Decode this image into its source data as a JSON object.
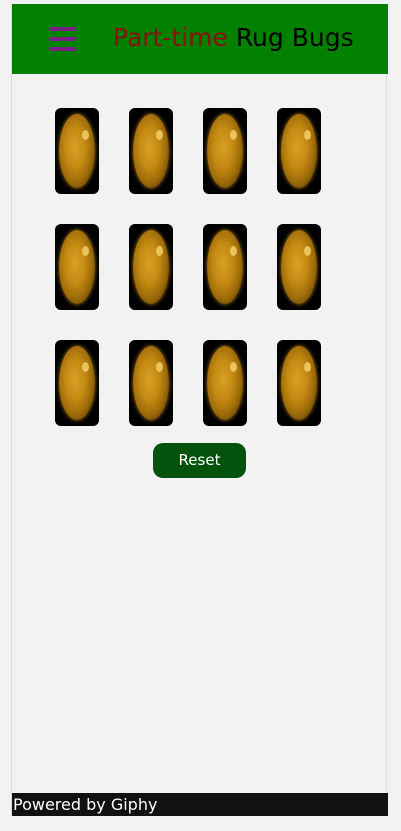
{
  "header": {
    "title_part1": "Part-time",
    "title_part2": "Rug Bugs",
    "menu_icon": "hamburger-menu-icon"
  },
  "colors": {
    "header_bg": "#018001",
    "title_part1": "#8b1010",
    "title_part2": "#000000",
    "menu_icon": "#7b1e86",
    "reset_button": "#03530c",
    "footer_bg": "#111111",
    "page_bg": "#f2f2f2"
  },
  "cards": [
    {
      "image": "sun-gif"
    },
    {
      "image": "sun-gif"
    },
    {
      "image": "sun-gif"
    },
    {
      "image": "sun-gif"
    },
    {
      "image": "sun-gif"
    },
    {
      "image": "sun-gif"
    },
    {
      "image": "sun-gif"
    },
    {
      "image": "sun-gif"
    },
    {
      "image": "sun-gif"
    },
    {
      "image": "sun-gif"
    },
    {
      "image": "sun-gif"
    },
    {
      "image": "sun-gif"
    }
  ],
  "reset_label": "Reset",
  "footer": {
    "text": "Powered by Giphy"
  }
}
